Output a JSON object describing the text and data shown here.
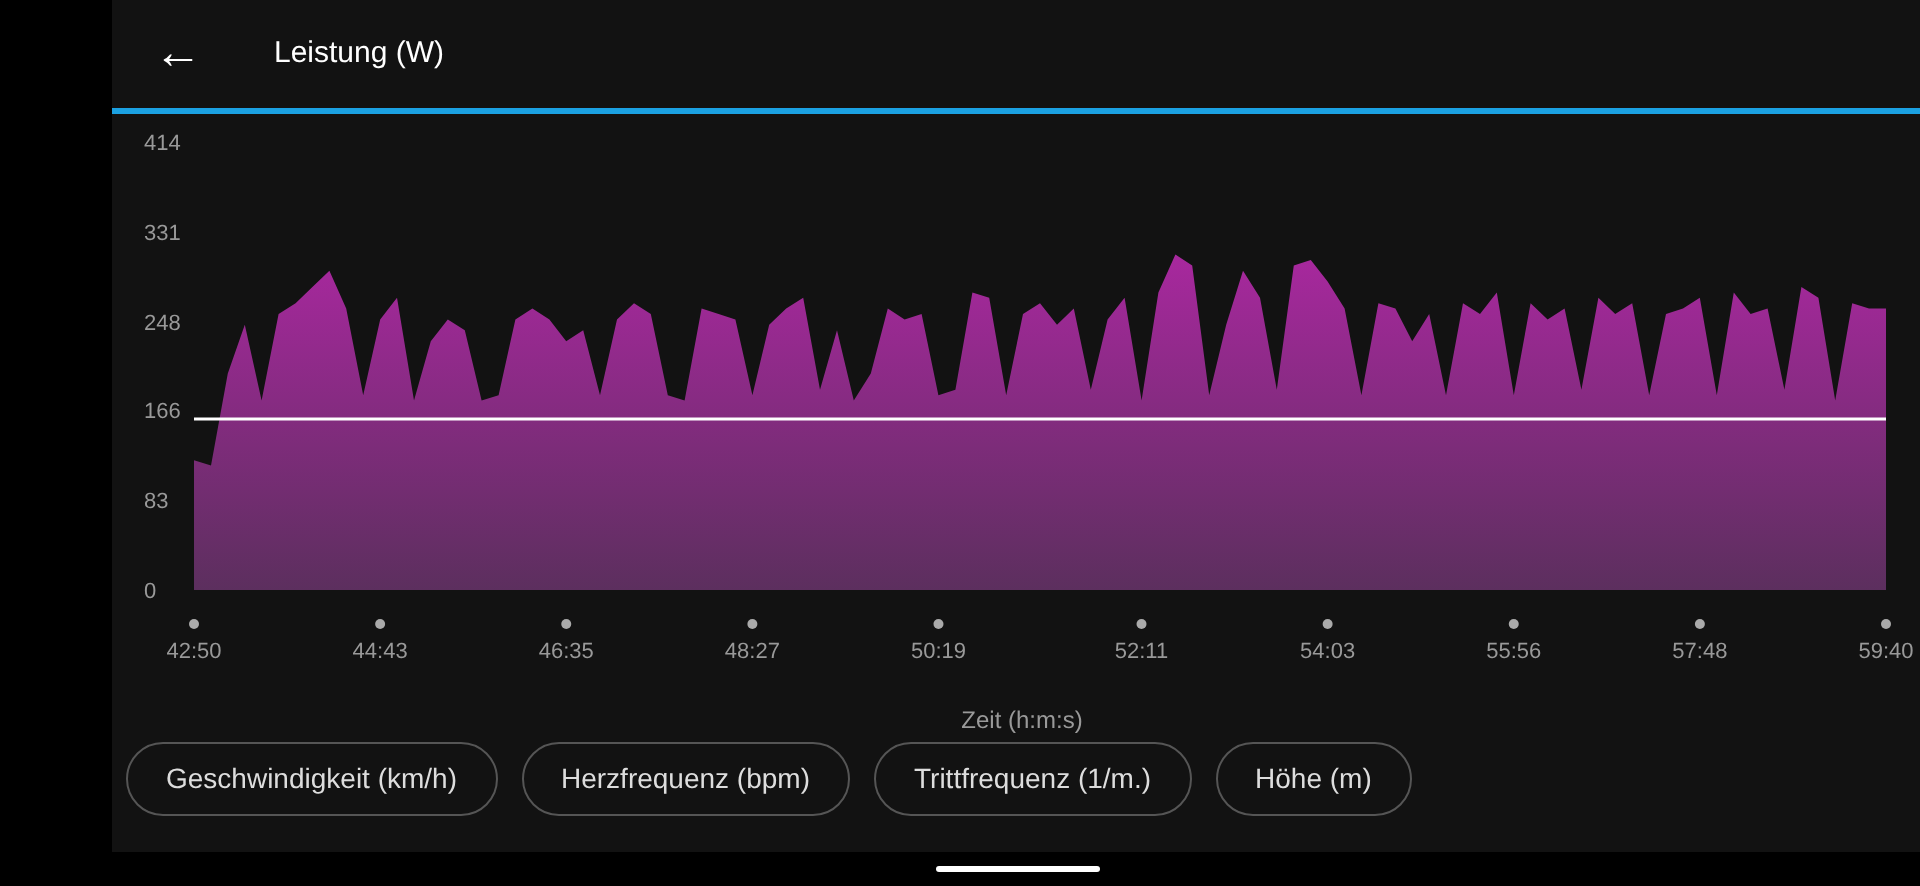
{
  "header": {
    "back": "←",
    "title": "Leistung (W)"
  },
  "chart": {
    "chart_data": {
      "type": "area",
      "xlabel": "Zeit (h:m:s)",
      "categories": [
        "42:50",
        null,
        null,
        null,
        null,
        null,
        null,
        null,
        null,
        null,
        null,
        "44:43",
        null,
        null,
        null,
        null,
        null,
        null,
        null,
        null,
        null,
        null,
        "46:35",
        null,
        null,
        null,
        null,
        null,
        null,
        null,
        null,
        null,
        null,
        "48:27",
        null,
        null,
        null,
        null,
        null,
        null,
        null,
        null,
        null,
        null,
        "50:19",
        null,
        null,
        null,
        null,
        null,
        null,
        null,
        null,
        null,
        null,
        null,
        "52:11",
        null,
        null,
        null,
        null,
        null,
        null,
        null,
        null,
        null,
        null,
        "54:03",
        null,
        null,
        null,
        null,
        null,
        null,
        null,
        null,
        null,
        null,
        "55:56",
        null,
        null,
        null,
        null,
        null,
        null,
        null,
        null,
        null,
        null,
        "57:48",
        null,
        null,
        null,
        null,
        null,
        null,
        null,
        null,
        null,
        null,
        "59:40"
      ],
      "values": [
        120,
        115,
        200,
        245,
        175,
        255,
        265,
        280,
        295,
        260,
        180,
        250,
        270,
        175,
        230,
        250,
        240,
        175,
        180,
        250,
        260,
        250,
        230,
        240,
        180,
        250,
        265,
        255,
        180,
        175,
        260,
        255,
        250,
        180,
        245,
        260,
        270,
        185,
        240,
        175,
        200,
        260,
        250,
        255,
        180,
        185,
        275,
        270,
        180,
        255,
        265,
        245,
        260,
        185,
        250,
        270,
        175,
        275,
        310,
        300,
        180,
        245,
        295,
        270,
        185,
        300,
        305,
        285,
        260,
        180,
        265,
        260,
        230,
        255,
        180,
        265,
        255,
        275,
        180,
        265,
        250,
        260,
        185,
        270,
        255,
        265,
        180,
        255,
        260,
        270,
        180,
        275,
        255,
        260,
        185,
        280,
        270,
        175,
        265,
        260,
        260
      ],
      "ylim": [
        0,
        414
      ],
      "yticks": [
        0,
        83,
        166,
        248,
        331,
        414
      ],
      "ref_lines": [
        {
          "axis": "y",
          "value": 158
        }
      ]
    }
  },
  "chips": [
    "Geschwindigkeit (km/h)",
    "Herzfrequenz (bpm)",
    "Trittfrequenz (1/m.)",
    "Höhe (m)"
  ]
}
